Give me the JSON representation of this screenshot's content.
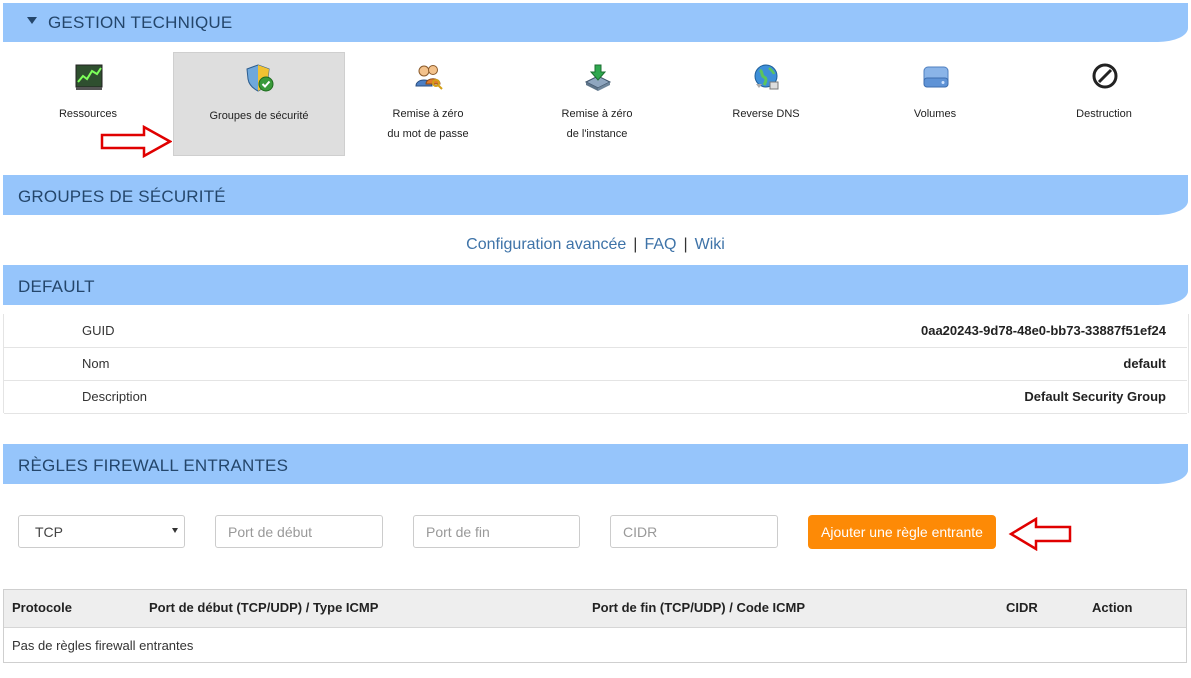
{
  "bands": {
    "tech": "GESTION TECHNIQUE",
    "security": "GROUPES DE SÉCURITÉ",
    "default": "DEFAULT",
    "firewall": "RÈGLES FIREWALL ENTRANTES"
  },
  "tools": [
    {
      "line1": "Ressources",
      "line2": "",
      "icon": "resources-chart-icon"
    },
    {
      "line1": "Groupes de sécurité",
      "line2": "",
      "icon": "security-shield-icon",
      "active": true
    },
    {
      "line1": "Remise à zéro",
      "line2": "du mot de passe",
      "icon": "users-key-icon"
    },
    {
      "line1": "Remise à zéro",
      "line2": "de l'instance",
      "icon": "instance-reset-icon"
    },
    {
      "line1": "Reverse DNS",
      "line2": "",
      "icon": "globe-dns-icon"
    },
    {
      "line1": "Volumes",
      "line2": "",
      "icon": "disk-volume-icon"
    },
    {
      "line1": "Destruction",
      "line2": "",
      "icon": "destroy-icon"
    }
  ],
  "links": {
    "advanced": "Configuration avancée",
    "faq": "FAQ",
    "wiki": "Wiki",
    "separator": "|"
  },
  "details": [
    {
      "key": "GUID",
      "value": "0aa20243-9d78-48e0-bb73-33887f51ef24"
    },
    {
      "key": "Nom",
      "value": "default"
    },
    {
      "key": "Description",
      "value": "Default Security Group"
    }
  ],
  "form": {
    "protocol": "TCP",
    "port_start_placeholder": "Port de début",
    "port_end_placeholder": "Port de fin",
    "cidr_placeholder": "CIDR",
    "add_button": "Ajouter une règle entrante"
  },
  "table": {
    "columns": [
      "Protocole",
      "Port de début (TCP/UDP) / Type ICMP",
      "Port de fin (TCP/UDP) / Code ICMP",
      "CIDR",
      "Action"
    ],
    "empty": "Pas de règles firewall entrantes"
  },
  "colors": {
    "band": "#96c5fb",
    "band_text": "#24466b",
    "link": "#3e73a8",
    "button": "#fd8a06",
    "annotation_arrow": "#e00000"
  }
}
